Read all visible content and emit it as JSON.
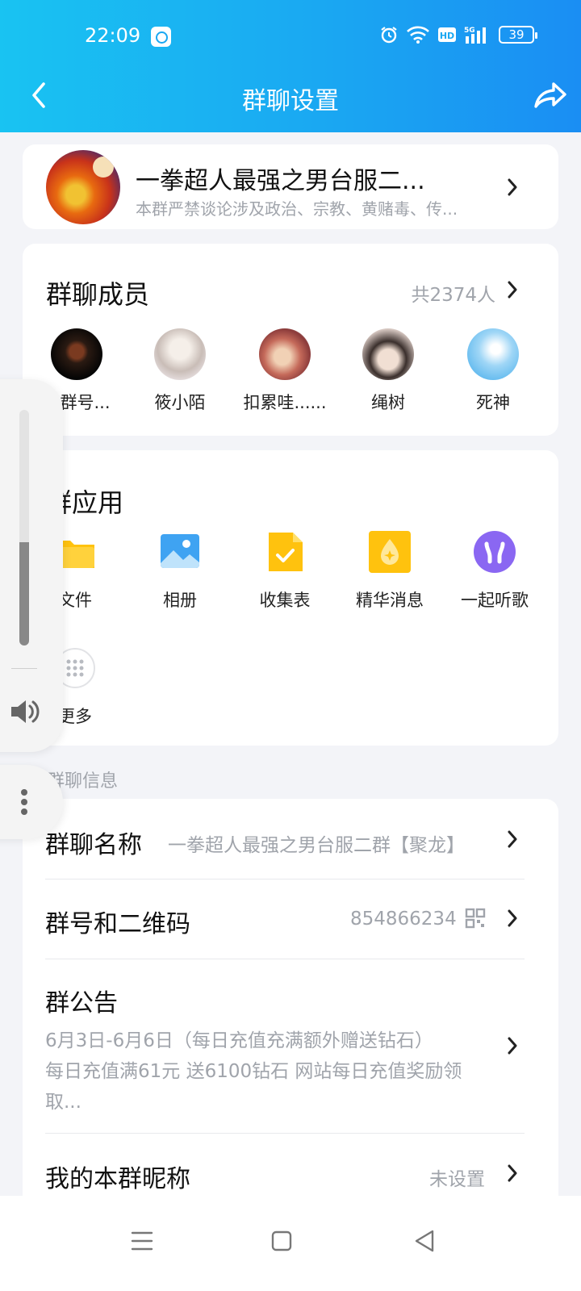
{
  "status": {
    "time": "22:09",
    "battery": "39",
    "network": "5G",
    "hd": "HD"
  },
  "header": {
    "title": "群聊设置"
  },
  "group": {
    "name": "一拳超人最强之男台服二...",
    "description": "本群严禁谈论涉及政治、宗教、黄赌毒、传..."
  },
  "members": {
    "title": "群聊成员",
    "count": "共2374人",
    "items": [
      {
        "name": "建群号..."
      },
      {
        "name": "筱小陌"
      },
      {
        "name": "扣累哇......"
      },
      {
        "name": "绳树"
      },
      {
        "name": "死神"
      }
    ]
  },
  "apps": {
    "title": "群应用",
    "items": [
      {
        "label": "文件",
        "icon": "folder-icon"
      },
      {
        "label": "相册",
        "icon": "photo-album-icon"
      },
      {
        "label": "收集表",
        "icon": "form-collect-icon"
      },
      {
        "label": "精华消息",
        "icon": "essence-message-icon"
      },
      {
        "label": "一起听歌",
        "icon": "headphones-icon"
      }
    ],
    "more": "更多"
  },
  "info": {
    "section_label": "群聊信息",
    "rows": [
      {
        "title": "群聊名称",
        "value": "一拳超人最强之男台服二群【聚龙】"
      },
      {
        "title": "群号和二维码",
        "value": "854866234"
      },
      {
        "title": "群公告",
        "line1": "6月3日-6月6日（每日充值充满额外赠送钻石）",
        "line2": "每日充值满61元 送6100钻石 网站每日充值奖励领",
        "line3": "取..."
      },
      {
        "title": "我的本群昵称",
        "value": "未设置"
      }
    ]
  },
  "colors": {
    "accent": "#1aa8f2",
    "muted": "#a0a4ab",
    "bg": "#f3f4f8"
  }
}
